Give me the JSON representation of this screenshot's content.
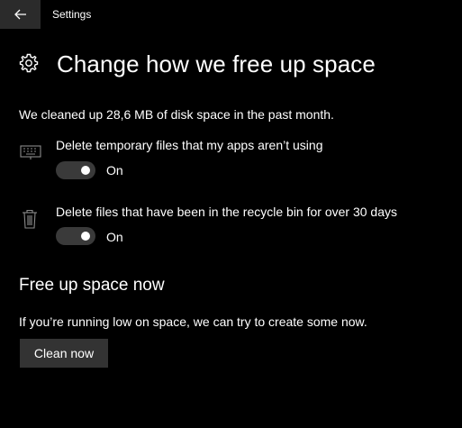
{
  "window": {
    "app_title": "Settings"
  },
  "header": {
    "title": "Change how we free up space",
    "icon": "gear-icon"
  },
  "summary": "We cleaned up 28,6 MB of disk space in the past month.",
  "settings": [
    {
      "icon": "keyboard-icon",
      "label": "Delete temporary files that my apps aren’t using",
      "state": "On",
      "on": true
    },
    {
      "icon": "recycle-bin-icon",
      "label": "Delete files that have been in the recycle bin for over 30 days",
      "state": "On",
      "on": true
    }
  ],
  "free_up": {
    "title": "Free up space now",
    "description": "If you’re running low on space, we can try to create some now.",
    "button_label": "Clean now"
  },
  "colors": {
    "background": "#000000",
    "toggle_track": "#3a3a3a",
    "button_bg": "#333333",
    "back_button_bg": "#2b2b2b"
  }
}
